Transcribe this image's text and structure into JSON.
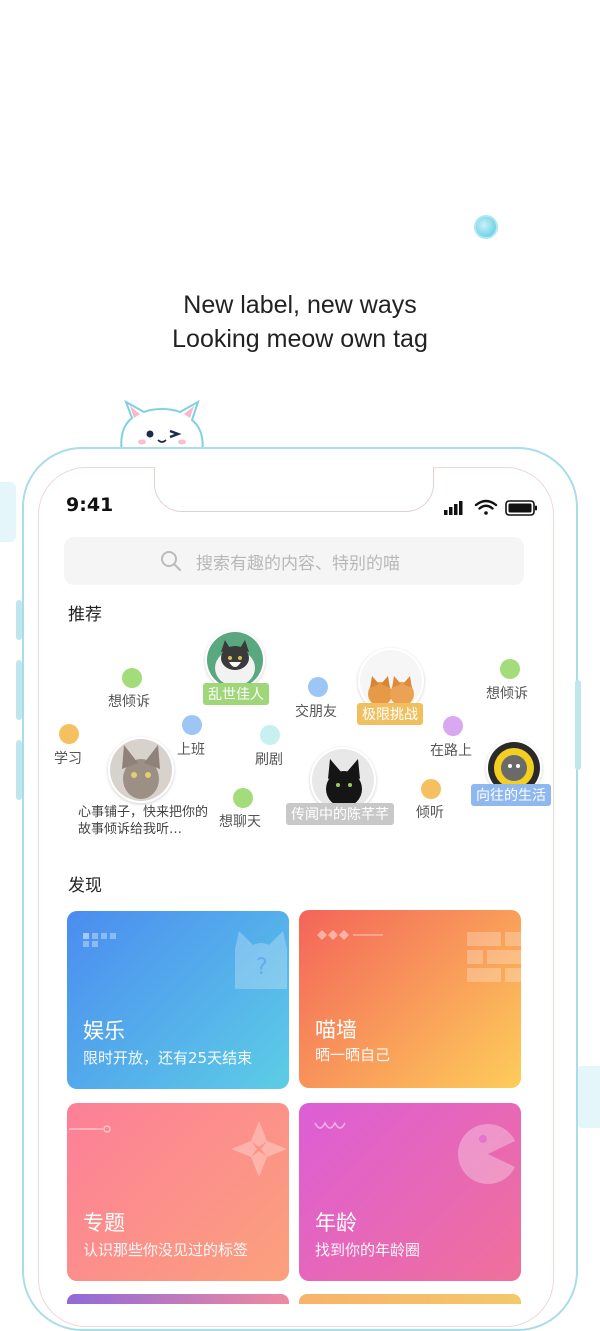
{
  "headline": {
    "line1": "New label, new ways",
    "line2": "Looking meow own tag"
  },
  "status_bar": {
    "time": "9:41"
  },
  "search": {
    "placeholder": "搜索有趣的内容、特别的喵"
  },
  "recommend": {
    "title": "推荐",
    "tags": [
      {
        "label": "想倾诉",
        "dot_color": "#a3dc7a"
      },
      {
        "label": "乱世佳人",
        "pill_color": "#9fd67a"
      },
      {
        "label": "交朋友",
        "dot_color": "#9cc7f5"
      },
      {
        "label": "极限挑战",
        "pill_color": "#f0c060"
      },
      {
        "label": "想倾诉",
        "dot_color": "#a3dc7a"
      },
      {
        "label": "学习",
        "dot_color": "#f5c060"
      },
      {
        "label": "上班",
        "dot_color": "#9cc7f5"
      },
      {
        "label": "刷剧",
        "dot_color": "#c9f0f0"
      },
      {
        "label": "在路上",
        "dot_color": "#d8a8f0"
      },
      {
        "label": "想聊天",
        "dot_color": "#a3dc7a"
      },
      {
        "label": "传闻中的陈芊芊",
        "pill_color": "#c8c8c8"
      },
      {
        "label": "倾听",
        "dot_color": "#f5c060"
      },
      {
        "label": "向往的生活",
        "pill_color": "#8fb8f0"
      }
    ],
    "story": "心事铺子，快来把你的故事倾诉给我听…"
  },
  "discover": {
    "title": "发现",
    "cards": [
      {
        "title": "娱乐",
        "subtitle": "限时开放，还有25天结束",
        "color_start": "#4b8cf0",
        "color_end": "#5dcde6"
      },
      {
        "title": "喵墙",
        "subtitle": "晒一晒自己",
        "color_start": "#f4645a",
        "color_end": "#fdcd5a"
      },
      {
        "title": "专题",
        "subtitle": "认识那些你没见过的标签",
        "color_start": "#fc7f98",
        "color_end": "#fba17c"
      },
      {
        "title": "年龄",
        "subtitle": "找到你的年龄圈",
        "color_start": "#dc5ed6",
        "color_end": "#f0709a"
      }
    ]
  }
}
